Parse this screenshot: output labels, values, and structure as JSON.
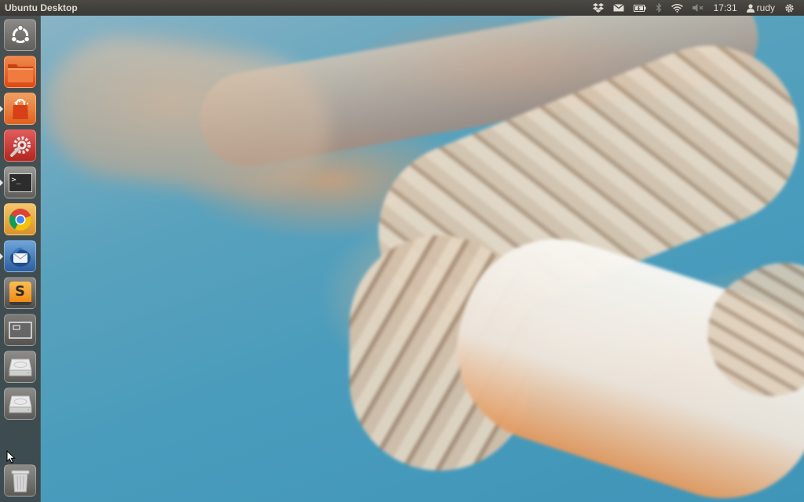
{
  "top_panel": {
    "title": "Ubuntu Desktop",
    "clock": "17:31",
    "user": "rudy"
  },
  "indicators": [
    {
      "icon": "dropbox-icon"
    },
    {
      "icon": "mail-icon"
    },
    {
      "icon": "battery-icon"
    },
    {
      "icon": "bluetooth-icon"
    },
    {
      "icon": "wifi-icon"
    },
    {
      "icon": "volume-muted-icon"
    },
    {
      "icon": "user-icon"
    },
    {
      "icon": "gear-icon"
    }
  ],
  "launcher": {
    "items": [
      {
        "name": "dash-home",
        "icon": "ubuntu-logo-icon",
        "running": false
      },
      {
        "name": "files",
        "icon": "folder-icon",
        "running": false
      },
      {
        "name": "software-center",
        "icon": "shopping-bag-icon",
        "running": true
      },
      {
        "name": "system-settings",
        "icon": "settings-icon",
        "running": false
      },
      {
        "name": "terminal",
        "icon": "terminal-icon",
        "running": true
      },
      {
        "name": "chrome",
        "icon": "chrome-icon",
        "running": false
      },
      {
        "name": "thunderbird",
        "icon": "thunderbird-icon",
        "running": true
      },
      {
        "name": "sublime-text",
        "icon": "sublime-icon",
        "running": false
      },
      {
        "name": "workspace-switcher",
        "icon": "workspace-icon",
        "running": false
      },
      {
        "name": "drive-1",
        "icon": "hard-drive-icon",
        "running": false
      },
      {
        "name": "drive-2",
        "icon": "hard-drive-icon",
        "running": false
      },
      {
        "name": "trash",
        "icon": "trash-icon",
        "running": false
      }
    ]
  },
  "colors": {
    "panel": "#3c3b37",
    "launcher": "#3a3a38",
    "ubuntu_orange": "#dd4814",
    "wallpaper_blue": "#4a9cbc"
  }
}
